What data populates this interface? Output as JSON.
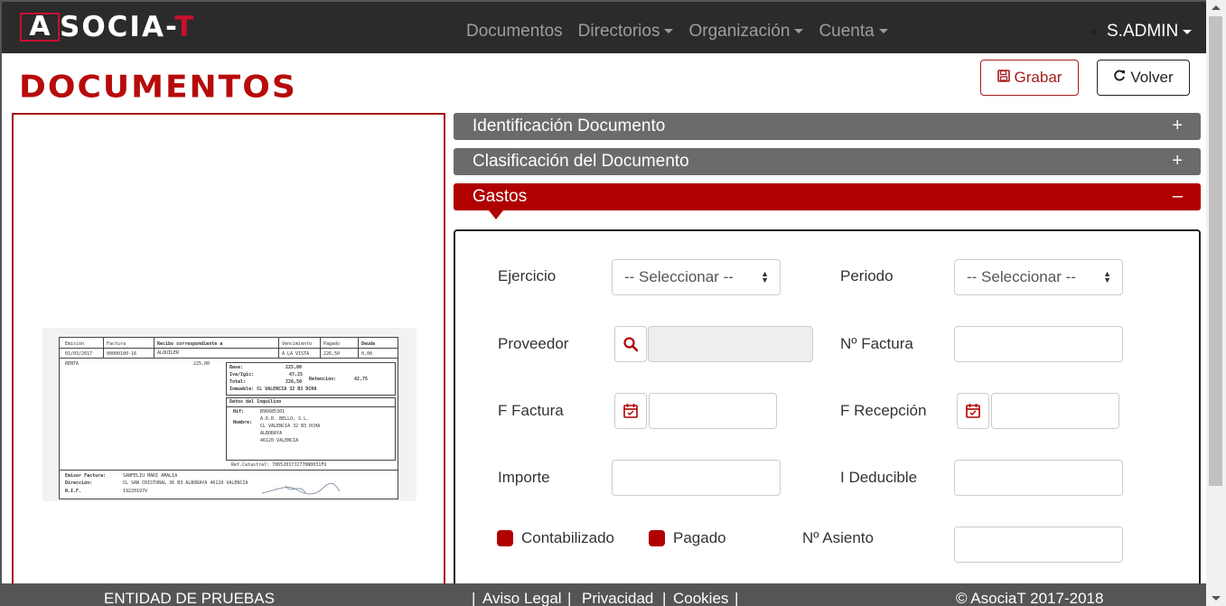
{
  "navbar": {
    "logo_letter": "A",
    "logo_rest": "SOCIA-",
    "logo_t": "T",
    "menu": [
      {
        "label": "Documentos"
      },
      {
        "label": "Directorios"
      },
      {
        "label": "Organización"
      },
      {
        "label": "Cuenta"
      }
    ],
    "user": "S.ADMIN"
  },
  "page": {
    "title": "DOCUMENTOS",
    "save_label": "Grabar",
    "back_label": "Volver"
  },
  "accordion": {
    "identificacion": "Identificación Documento",
    "clasificacion": "Clasificación del Documento",
    "gastos": "Gastos",
    "plus": "+",
    "minus": "–"
  },
  "form": {
    "ejercicio_label": "Ejercicio",
    "ejercicio_value": "-- Seleccionar --",
    "periodo_label": "Periodo",
    "periodo_value": "-- Seleccionar --",
    "proveedor_label": "Proveedor",
    "nfactura_label": "Nº Factura",
    "ffactura_label": "F Factura",
    "frecepcion_label": "F Recepción",
    "importe_label": "Importe",
    "ideducible_label": "I Deducible",
    "contabilizado_label": "Contabilizado",
    "pagado_label": "Pagado",
    "nasiento_label": "Nº Asiento"
  },
  "document_preview": {
    "h1": "Emisión",
    "h2": "Factura",
    "h3": "Recibo correspondiente a",
    "h4": "Vencimiento",
    "h5": "Pagado",
    "h6": "Deuda",
    "r1": "01/03/2017",
    "r2": "00000100-16",
    "r3": "ALQUILER",
    "r4": "A LA VISTA",
    "r5": "226,50",
    "r6": "0,00",
    "concept": "RENTA",
    "concept_amount": "225,00",
    "base_l": "Base:",
    "base_v": "225,00",
    "iva_l": "Iva/Igic:",
    "iva_v": "47,25",
    "ret_l": "Retención:",
    "ret_v": "42,75",
    "total_l": "Total:",
    "total_v": "226,50",
    "inmueble": "Inmueble: CL VALENCIA 32 B3 DCHA",
    "inquilino": "Datos del Inquilino",
    "nif_l": "Nif:",
    "nif_v": "B96685301",
    "nombre_l": "Nombre:",
    "nombre_1": "A.D.R. BELLO, S.L.",
    "nombre_2": "CL VALENCIA 32 B3 DCHA",
    "nombre_3": "ALBORAYA",
    "nombre_4": "46120 VALENCIA",
    "ref": "Ref.Catastral: 7865201YJ2776N0031FU",
    "emisor_l": "Emisor Factura:",
    "emisor_v": "SANFELIU MARI AMALIA",
    "dir_l": "Dirección:",
    "dir_v": "CL SAN CRISTOBAL 36 B3 ALBORAYA 46120 VALENCIA",
    "cif_l": "N.I.F.",
    "cif_v": "19220197V"
  },
  "footer": {
    "entity": "ENTIDAD DE PRUEBAS",
    "sep1": "|",
    "aviso": "Aviso Legal",
    "sep2": "|",
    "privacidad": "Privacidad",
    "sep3": "|",
    "cookies": "Cookies",
    "sep4": "|",
    "copyright": "© AsociaT 2017-2018"
  },
  "colors": {
    "brand_red": "#b00000",
    "navbar": "#2b2b2b",
    "accordion_gray": "#6b6b6b"
  }
}
